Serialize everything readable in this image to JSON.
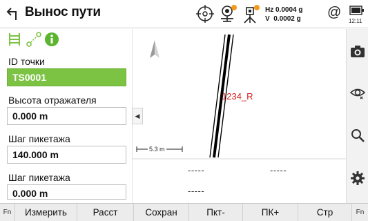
{
  "header": {
    "title": "Вынос пути",
    "hz": "Hz 0.0004 g",
    "v": "V  0.0002 g",
    "at": "@",
    "time": "12:11"
  },
  "form": {
    "fields": [
      {
        "label": "ID точки",
        "value": "TS0001"
      },
      {
        "label": "Высота отражателя",
        "value": "0.000 m"
      },
      {
        "label": "Шаг пикетажа",
        "value": "140.000 m"
      },
      {
        "label": "Шаг пикетажа",
        "value": "0.000 m"
      }
    ]
  },
  "map": {
    "line_label": "1234_R",
    "scale_text": "5.3 m",
    "dash_values": [
      "-----",
      "-----",
      "-----"
    ],
    "colors": {
      "label": "#d42020",
      "line": "#000000"
    }
  },
  "right_tools": [
    "camera-icon",
    "eye-icon",
    "search-icon",
    "gear-icon"
  ],
  "softkeys": {
    "fn_left": "Fn",
    "measure": "Измерить",
    "dist": "Расст",
    "save": "Сохран",
    "sta_minus": "Пкт-",
    "sta_plus": "ПК+",
    "page": "Стр",
    "fn_right": "Fn"
  },
  "colors": {
    "accent_green": "#7cc243",
    "badge_orange": "#f39a1e"
  }
}
